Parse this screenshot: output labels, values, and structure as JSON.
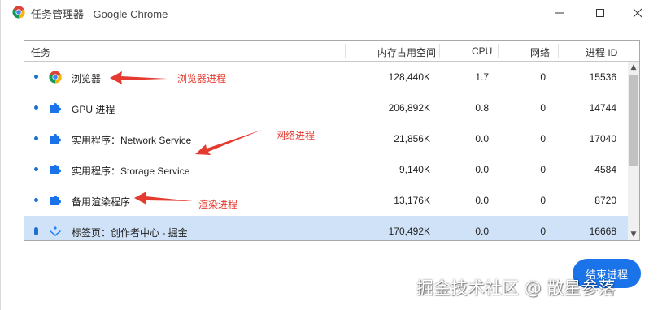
{
  "window": {
    "title": "任务管理器 - Google Chrome",
    "minimize_icon": "minimize-icon",
    "maximize_icon": "maximize-icon",
    "close_icon": "close-icon"
  },
  "table": {
    "columns": {
      "task": "任务",
      "memory": "内存占用空间",
      "cpu": "CPU",
      "network": "网络",
      "pid": "进程 ID"
    },
    "rows": [
      {
        "icon": "chrome-icon",
        "name": "浏览器",
        "memory": "128,440K",
        "cpu": "1.7",
        "network": "0",
        "pid": "15536"
      },
      {
        "icon": "puzzle-icon",
        "name": "GPU 进程",
        "memory": "206,892K",
        "cpu": "0.8",
        "network": "0",
        "pid": "14744"
      },
      {
        "icon": "puzzle-icon",
        "name": "实用程序：Network Service",
        "memory": "21,856K",
        "cpu": "0.0",
        "network": "0",
        "pid": "17040"
      },
      {
        "icon": "puzzle-icon",
        "name": "实用程序：Storage Service",
        "memory": "9,140K",
        "cpu": "0.0",
        "network": "0",
        "pid": "4584"
      },
      {
        "icon": "puzzle-icon",
        "name": "备用渲染程序",
        "memory": "13,176K",
        "cpu": "0.0",
        "network": "0",
        "pid": "8720"
      },
      {
        "icon": "juejin-icon",
        "name": "标签页：创作者中心 - 掘金",
        "memory": "170,492K",
        "cpu": "0.0",
        "network": "0",
        "pid": "16668"
      }
    ]
  },
  "end_process_button": "结束进程",
  "annotations": {
    "browser": "浏览器进程",
    "network": "网络进程",
    "render": "渲染进程"
  },
  "watermark": "掘金技术社区 @ 散星参落",
  "colors": {
    "accent": "#1a73e8",
    "annotation": "#e53a2f",
    "selected_row": "#cfe2f7"
  }
}
